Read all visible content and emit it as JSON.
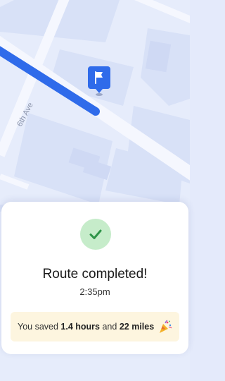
{
  "map": {
    "street_label": "6th Ave",
    "route_color": "#2f6bea",
    "destination_icon": "flag-pin-icon"
  },
  "completion": {
    "status_icon": "checkmark-icon",
    "title": "Route completed!",
    "time": "2:35pm",
    "savings": {
      "prefix": "You saved",
      "hours": "1.4 hours",
      "connector": "and",
      "miles": "22 miles",
      "icon": "party-popper-icon"
    }
  }
}
